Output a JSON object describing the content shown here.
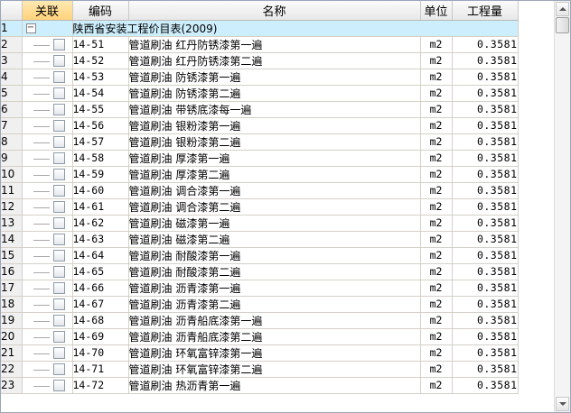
{
  "columns": {
    "assoc": "关联",
    "code": "编码",
    "name": "名称",
    "unit": "单位",
    "qty": "工程量"
  },
  "group": {
    "index": "1",
    "title": "陕西省安装工程价目表(2009)",
    "expander": "−"
  },
  "rows": [
    {
      "index": "2",
      "code": "14-51",
      "name": "管道刷油 红丹防锈漆第一遍",
      "unit": "m2",
      "qty": "0.3581"
    },
    {
      "index": "3",
      "code": "14-52",
      "name": "管道刷油 红丹防锈漆第二遍",
      "unit": "m2",
      "qty": "0.3581"
    },
    {
      "index": "4",
      "code": "14-53",
      "name": "管道刷油 防锈漆第一遍",
      "unit": "m2",
      "qty": "0.3581"
    },
    {
      "index": "5",
      "code": "14-54",
      "name": "管道刷油 防锈漆第二遍",
      "unit": "m2",
      "qty": "0.3581"
    },
    {
      "index": "6",
      "code": "14-55",
      "name": "管道刷油 带锈底漆每一遍",
      "unit": "m2",
      "qty": "0.3581"
    },
    {
      "index": "7",
      "code": "14-56",
      "name": "管道刷油 银粉漆第一遍",
      "unit": "m2",
      "qty": "0.3581"
    },
    {
      "index": "8",
      "code": "14-57",
      "name": "管道刷油 银粉漆第二遍",
      "unit": "m2",
      "qty": "0.3581"
    },
    {
      "index": "9",
      "code": "14-58",
      "name": "管道刷油 厚漆第一遍",
      "unit": "m2",
      "qty": "0.3581"
    },
    {
      "index": "10",
      "code": "14-59",
      "name": "管道刷油 厚漆第二遍",
      "unit": "m2",
      "qty": "0.3581"
    },
    {
      "index": "11",
      "code": "14-60",
      "name": "管道刷油 调合漆第一遍",
      "unit": "m2",
      "qty": "0.3581"
    },
    {
      "index": "12",
      "code": "14-61",
      "name": "管道刷油 调合漆第二遍",
      "unit": "m2",
      "qty": "0.3581"
    },
    {
      "index": "13",
      "code": "14-62",
      "name": "管道刷油 磁漆第一遍",
      "unit": "m2",
      "qty": "0.3581"
    },
    {
      "index": "14",
      "code": "14-63",
      "name": "管道刷油 磁漆第二遍",
      "unit": "m2",
      "qty": "0.3581"
    },
    {
      "index": "15",
      "code": "14-64",
      "name": "管道刷油 耐酸漆第一遍",
      "unit": "m2",
      "qty": "0.3581"
    },
    {
      "index": "16",
      "code": "14-65",
      "name": "管道刷油 耐酸漆第二遍",
      "unit": "m2",
      "qty": "0.3581"
    },
    {
      "index": "17",
      "code": "14-66",
      "name": "管道刷油 沥青漆第一遍",
      "unit": "m2",
      "qty": "0.3581"
    },
    {
      "index": "18",
      "code": "14-67",
      "name": "管道刷油 沥青漆第二遍",
      "unit": "m2",
      "qty": "0.3581"
    },
    {
      "index": "19",
      "code": "14-68",
      "name": "管道刷油 沥青船底漆第一遍",
      "unit": "m2",
      "qty": "0.3581"
    },
    {
      "index": "20",
      "code": "14-69",
      "name": "管道刷油 沥青船底漆第二遍",
      "unit": "m2",
      "qty": "0.3581"
    },
    {
      "index": "21",
      "code": "14-70",
      "name": "管道刷油 环氧富锌漆第一遍",
      "unit": "m2",
      "qty": "0.3581"
    },
    {
      "index": "22",
      "code": "14-71",
      "name": "管道刷油 环氧富锌漆第二遍",
      "unit": "m2",
      "qty": "0.3581"
    },
    {
      "index": "23",
      "code": "14-72",
      "name": "管道刷油 热沥青第一遍",
      "unit": "m2",
      "qty": "0.3581"
    }
  ]
}
